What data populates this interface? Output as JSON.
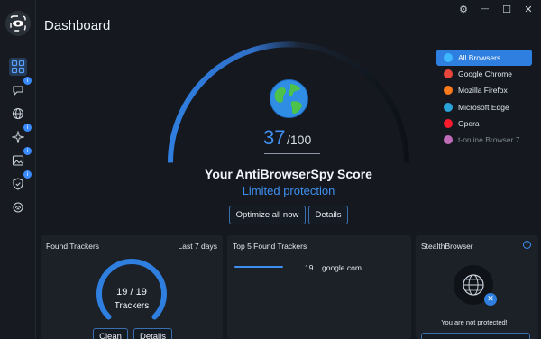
{
  "app": {
    "title": "Dashboard"
  },
  "window_controls": [
    {
      "name": "settings-icon",
      "glyph": "⚙"
    },
    {
      "name": "minimize-icon",
      "glyph": "—"
    },
    {
      "name": "maximize-icon",
      "glyph": "☐"
    },
    {
      "name": "close-icon",
      "glyph": "✕"
    }
  ],
  "sidebar": {
    "items": [
      {
        "name": "dashboard",
        "icon": "grid-icon",
        "active": true,
        "badge": ""
      },
      {
        "name": "chat",
        "icon": "chat-icon",
        "active": false,
        "badge": "i"
      },
      {
        "name": "web",
        "icon": "globe-icon",
        "active": false,
        "badge": ""
      },
      {
        "name": "sparkle",
        "icon": "sparkle-icon",
        "active": false,
        "badge": "i"
      },
      {
        "name": "image",
        "icon": "image-icon",
        "active": false,
        "badge": "i"
      },
      {
        "name": "shield",
        "icon": "shield-icon",
        "active": false,
        "badge": "i"
      },
      {
        "name": "fingerprint",
        "icon": "fingerprint-icon",
        "active": false,
        "badge": ""
      }
    ]
  },
  "score": {
    "value": "37",
    "max": "/100",
    "level": 0.37,
    "title": "Your AntiBrowserSpy Score",
    "status": "Limited protection",
    "optimize_label": "Optimize all now",
    "details_label": "Details"
  },
  "browsers": [
    {
      "label": "All Browsers",
      "icon": "all-browsers-icon",
      "active": true,
      "muted": false,
      "color": "#3fb7ff"
    },
    {
      "label": "Google Chrome",
      "icon": "chrome-icon",
      "active": false,
      "muted": false,
      "color": "#e7463c"
    },
    {
      "label": "Mozilla Firefox",
      "icon": "firefox-icon",
      "active": false,
      "muted": false,
      "color": "#ff7a1a"
    },
    {
      "label": "Microsoft Edge",
      "icon": "edge-icon",
      "active": false,
      "muted": false,
      "color": "#29a3d8"
    },
    {
      "label": "Opera",
      "icon": "opera-icon",
      "active": false,
      "muted": false,
      "color": "#ff1b2d"
    },
    {
      "label": "t-online Browser 7",
      "icon": "t-online-icon",
      "active": false,
      "muted": true,
      "color": "#c06bb7"
    }
  ],
  "found_trackers": {
    "title": "Found Trackers",
    "period": "Last 7 days",
    "value": "19 / 19",
    "label": "Trackers",
    "fraction": 1.0,
    "clean_label": "Clean",
    "details_label": "Details"
  },
  "top_trackers": {
    "title": "Top 5 Found Trackers",
    "items": [
      {
        "count": "19",
        "domain": "google.com",
        "fraction": 1.0
      }
    ]
  },
  "stealth": {
    "title": "StealthBrowser",
    "message": "You are not protected!",
    "help_glyph": "?",
    "badge_glyph": "✕"
  },
  "colors": {
    "accent": "#3f8ff0",
    "background": "#15191f",
    "panel": "#1c2128"
  }
}
